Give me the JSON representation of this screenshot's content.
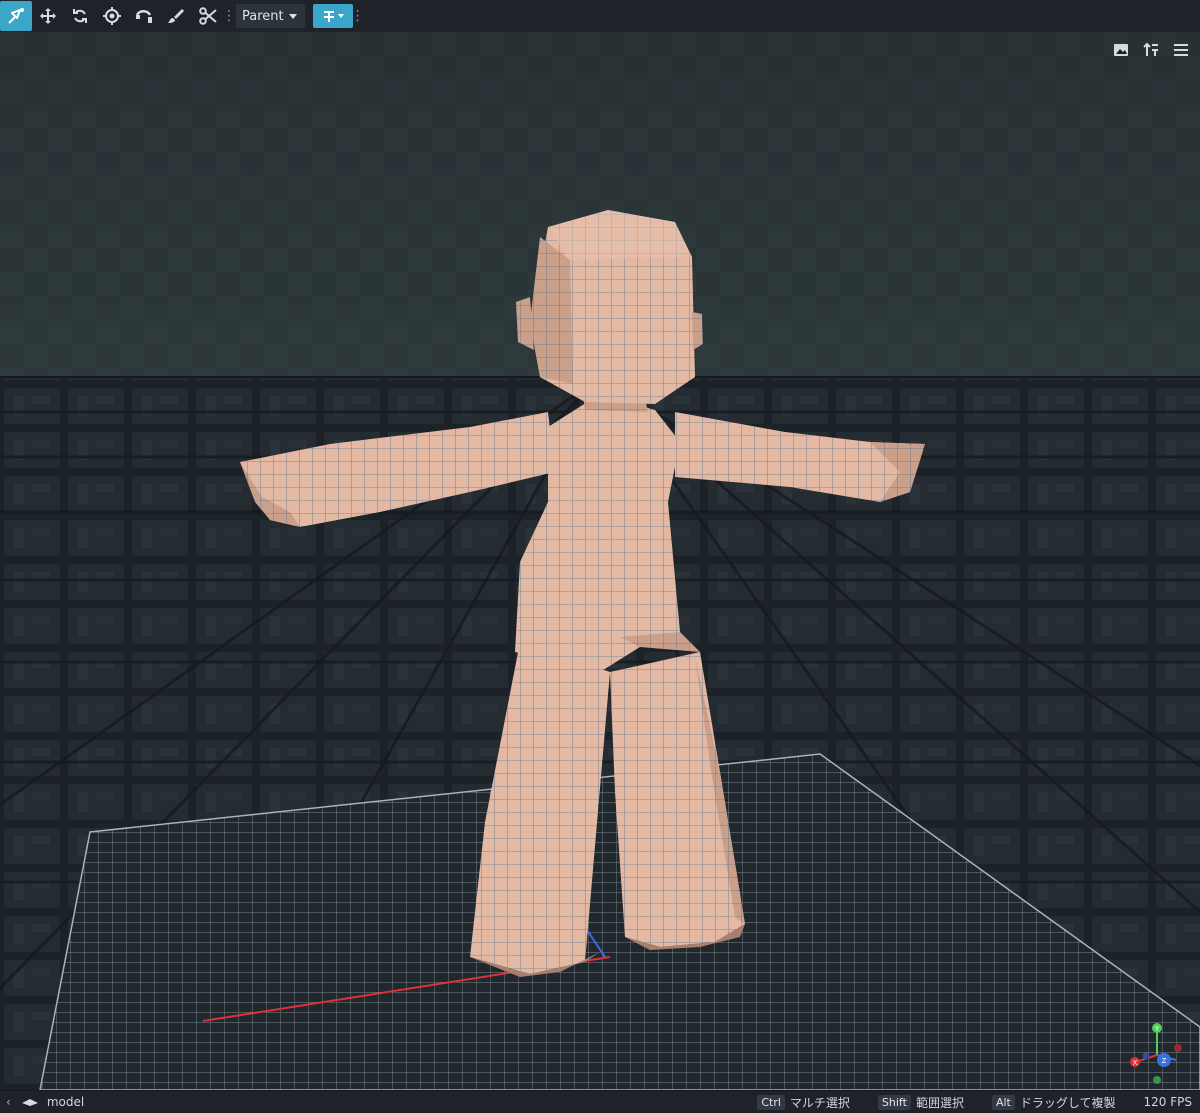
{
  "toolbar": {
    "tools": [
      {
        "name": "vertex-snap-icon",
        "active": true
      },
      {
        "name": "move-icon",
        "active": false
      },
      {
        "name": "rotate-icon",
        "active": false
      },
      {
        "name": "pivot-icon",
        "active": false
      },
      {
        "name": "vertex-pivot-icon",
        "active": false
      },
      {
        "name": "brush-icon",
        "active": false
      },
      {
        "name": "scissors-icon",
        "active": false
      }
    ],
    "space_select": "Parent",
    "accent_color": "#3aa6c9"
  },
  "viewport": {
    "tools": [
      "image-icon",
      "sort-icon",
      "menu-icon"
    ],
    "gizmo_axes": [
      "Y",
      "X",
      "Z"
    ]
  },
  "status": {
    "element_name": "model",
    "hints": [
      {
        "key": "Ctrl",
        "label": "マルチ選択"
      },
      {
        "key": "Shift",
        "label": "範囲選択"
      },
      {
        "key": "Alt",
        "label": "ドラッグして複製"
      }
    ],
    "fps": "120 FPS"
  }
}
